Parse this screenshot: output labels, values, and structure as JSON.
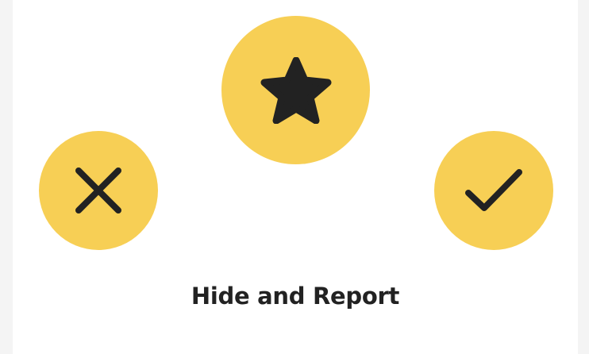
{
  "colors": {
    "page_background": "#f4f4f4",
    "card_background": "#ffffff",
    "button_fill": "#f7cf55",
    "icon_color": "#222222",
    "label_color": "#222222"
  },
  "buttons": {
    "favorite": {
      "icon": "star-icon"
    },
    "dismiss": {
      "icon": "close-icon"
    },
    "confirm": {
      "icon": "check-icon"
    }
  },
  "action_label": "Hide and Report"
}
